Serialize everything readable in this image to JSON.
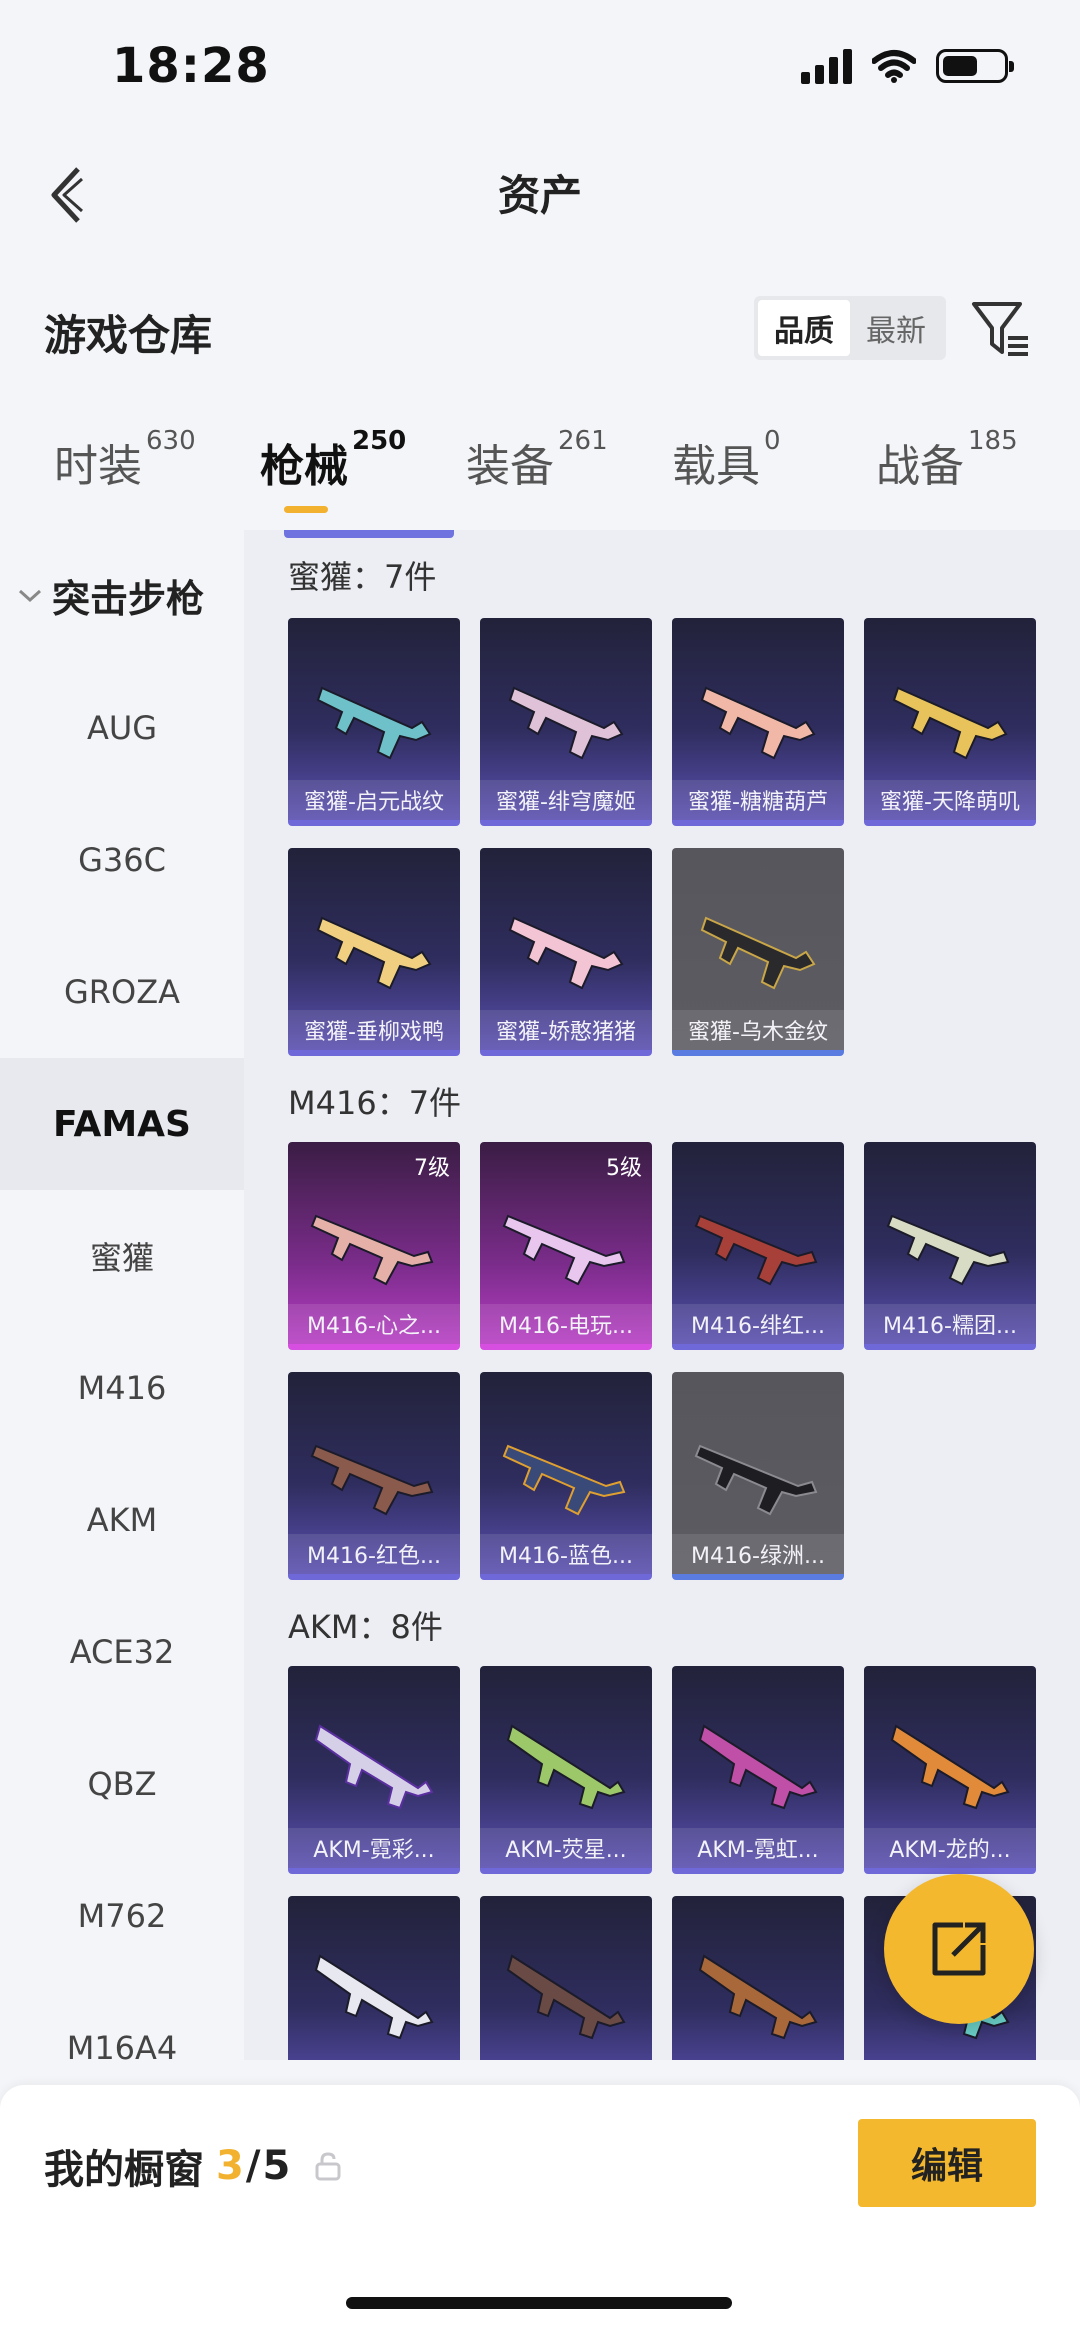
{
  "status": {
    "time": "18:28"
  },
  "nav": {
    "title": "资产"
  },
  "header": {
    "title": "游戏仓库",
    "sort_options": [
      "品质",
      "最新"
    ]
  },
  "tabs": [
    {
      "label": "时装",
      "count": "630"
    },
    {
      "label": "枪械",
      "count": "250"
    },
    {
      "label": "装备",
      "count": "261"
    },
    {
      "label": "载具",
      "count": "0"
    },
    {
      "label": "战备",
      "count": "185"
    }
  ],
  "sidebar": {
    "group": "突击步枪",
    "items": [
      "AUG",
      "G36C",
      "GROZA",
      "FAMAS",
      "蜜獾",
      "M416",
      "AKM",
      "ACE32",
      "QBZ",
      "M762",
      "M16A4"
    ]
  },
  "sections": [
    {
      "title": "蜜獾：7件",
      "items": [
        {
          "label": "蜜獾-启元战纹",
          "level": ""
        },
        {
          "label": "蜜獾-绯穹魔姬",
          "level": ""
        },
        {
          "label": "蜜獾-糖糖葫芦",
          "level": ""
        },
        {
          "label": "蜜獾-天降萌叽",
          "level": ""
        },
        {
          "label": "蜜獾-垂柳戏鸭",
          "level": ""
        },
        {
          "label": "蜜獾-娇憨猪猪",
          "level": ""
        },
        {
          "label": "蜜獾-乌木金纹",
          "level": ""
        }
      ]
    },
    {
      "title": "M416：7件",
      "items": [
        {
          "label": "M416-心之...",
          "level": "7级"
        },
        {
          "label": "M416-电玩...",
          "level": "5级"
        },
        {
          "label": "M416-绯红...",
          "level": ""
        },
        {
          "label": "M416-糯团...",
          "level": ""
        },
        {
          "label": "M416-红色...",
          "level": ""
        },
        {
          "label": "M416-蓝色...",
          "level": ""
        },
        {
          "label": "M416-绿洲...",
          "level": ""
        }
      ]
    },
    {
      "title": "AKM：8件",
      "items": [
        {
          "label": "AKM-霓彩...",
          "level": ""
        },
        {
          "label": "AKM-荧星...",
          "level": ""
        },
        {
          "label": "AKM-霓虹...",
          "level": ""
        },
        {
          "label": "AKM-龙的...",
          "level": ""
        }
      ]
    }
  ],
  "bottom": {
    "title": "我的橱窗",
    "count": "3",
    "total": "5",
    "edit_label": "编辑"
  },
  "colors": {
    "accent": "#f4b82e",
    "card_purple": "#2f2d5e",
    "card_pink": "#7a2c8a",
    "card_grey": "#5c5c62"
  }
}
